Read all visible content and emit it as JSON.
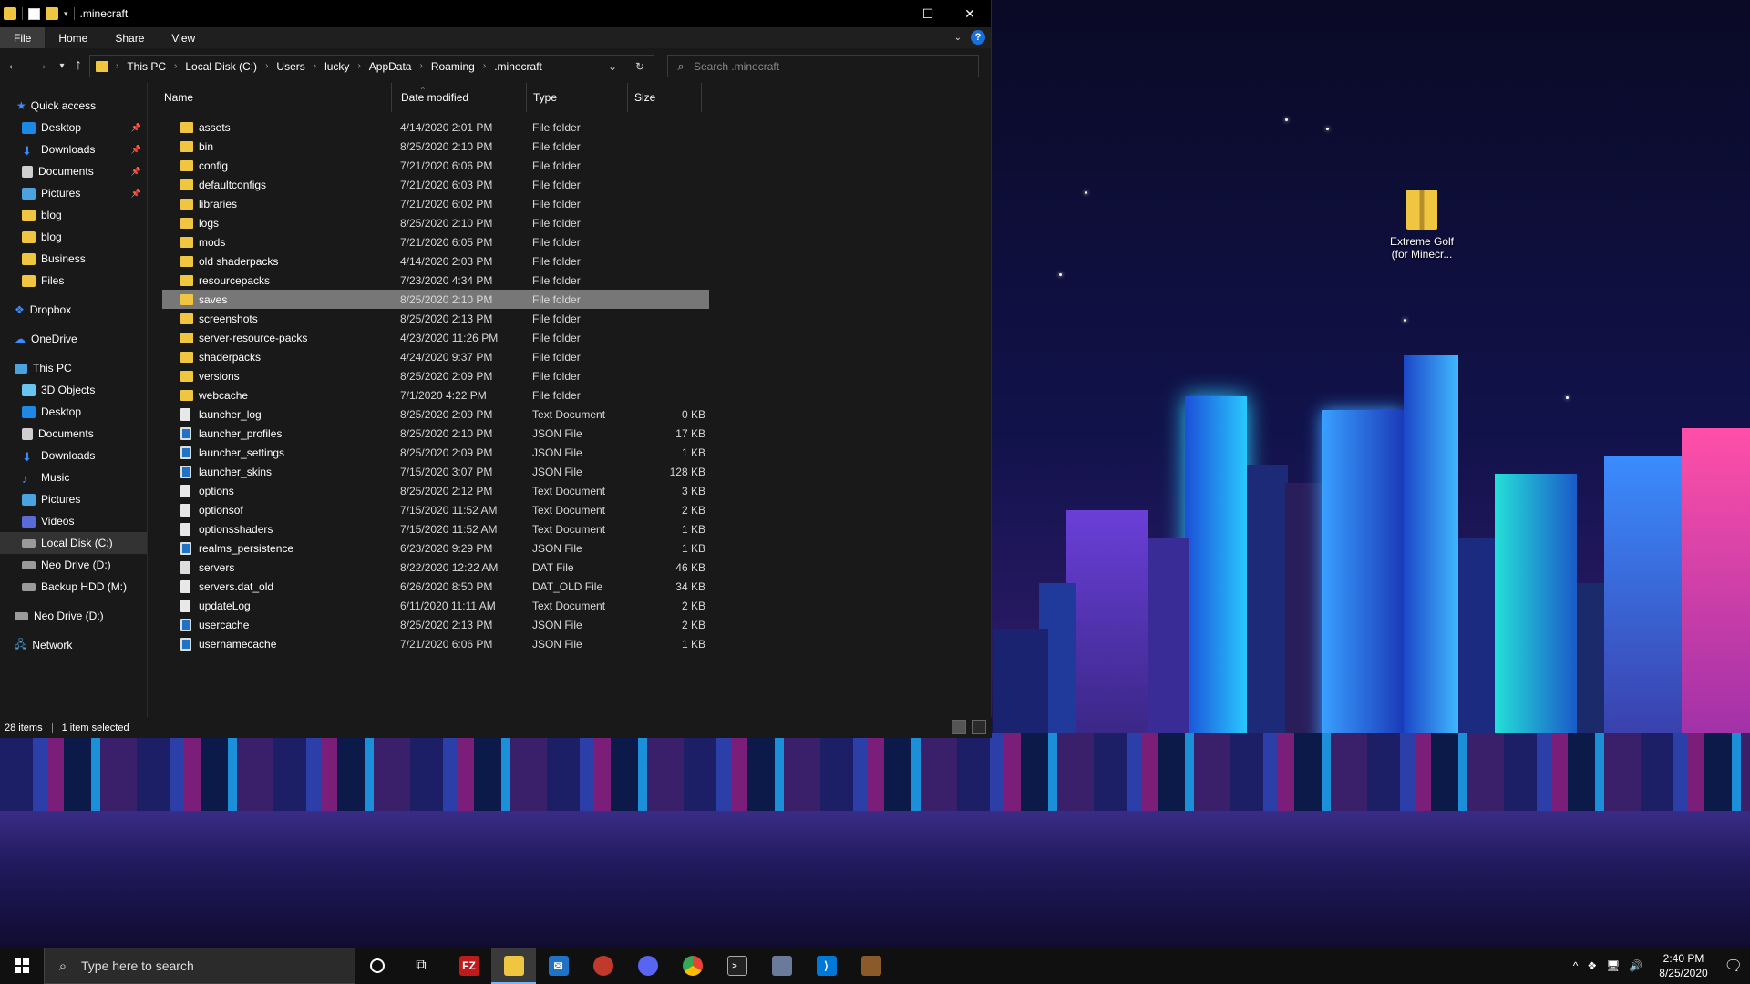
{
  "explorer": {
    "title": ".minecraft",
    "ribbon_tabs": [
      "File",
      "Home",
      "Share",
      "View"
    ],
    "breadcrumb": [
      "This PC",
      "Local Disk (C:)",
      "Users",
      "lucky",
      "AppData",
      "Roaming",
      ".minecraft"
    ],
    "search_placeholder": "Search .minecraft",
    "columns": {
      "name": "Name",
      "date": "Date modified",
      "type": "Type",
      "size": "Size"
    },
    "nav": {
      "quick_access": "Quick access",
      "quick_items": [
        "Desktop",
        "Downloads",
        "Documents",
        "Pictures",
        "blog",
        "blog",
        "Business",
        "Files"
      ],
      "dropbox": "Dropbox",
      "onedrive": "OneDrive",
      "this_pc": "This PC",
      "pc_items": [
        "3D Objects",
        "Desktop",
        "Documents",
        "Downloads",
        "Music",
        "Pictures",
        "Videos",
        "Local Disk (C:)",
        "Neo Drive (D:)",
        "Backup HDD (M:)"
      ],
      "neo_drive": "Neo Drive (D:)",
      "network": "Network"
    },
    "files": [
      {
        "name": "assets",
        "date": "4/14/2020 2:01 PM",
        "type": "File folder",
        "size": "",
        "kind": "folder"
      },
      {
        "name": "bin",
        "date": "8/25/2020 2:10 PM",
        "type": "File folder",
        "size": "",
        "kind": "folder"
      },
      {
        "name": "config",
        "date": "7/21/2020 6:06 PM",
        "type": "File folder",
        "size": "",
        "kind": "folder"
      },
      {
        "name": "defaultconfigs",
        "date": "7/21/2020 6:03 PM",
        "type": "File folder",
        "size": "",
        "kind": "folder"
      },
      {
        "name": "libraries",
        "date": "7/21/2020 6:02 PM",
        "type": "File folder",
        "size": "",
        "kind": "folder"
      },
      {
        "name": "logs",
        "date": "8/25/2020 2:10 PM",
        "type": "File folder",
        "size": "",
        "kind": "folder"
      },
      {
        "name": "mods",
        "date": "7/21/2020 6:05 PM",
        "type": "File folder",
        "size": "",
        "kind": "folder"
      },
      {
        "name": "old shaderpacks",
        "date": "4/14/2020 2:03 PM",
        "type": "File folder",
        "size": "",
        "kind": "folder"
      },
      {
        "name": "resourcepacks",
        "date": "7/23/2020 4:34 PM",
        "type": "File folder",
        "size": "",
        "kind": "folder"
      },
      {
        "name": "saves",
        "date": "8/25/2020 2:10 PM",
        "type": "File folder",
        "size": "",
        "kind": "folder",
        "selected": true
      },
      {
        "name": "screenshots",
        "date": "8/25/2020 2:13 PM",
        "type": "File folder",
        "size": "",
        "kind": "folder"
      },
      {
        "name": "server-resource-packs",
        "date": "4/23/2020 11:26 PM",
        "type": "File folder",
        "size": "",
        "kind": "folder"
      },
      {
        "name": "shaderpacks",
        "date": "4/24/2020 9:37 PM",
        "type": "File folder",
        "size": "",
        "kind": "folder"
      },
      {
        "name": "versions",
        "date": "8/25/2020 2:09 PM",
        "type": "File folder",
        "size": "",
        "kind": "folder"
      },
      {
        "name": "webcache",
        "date": "7/1/2020 4:22 PM",
        "type": "File folder",
        "size": "",
        "kind": "folder"
      },
      {
        "name": "launcher_log",
        "date": "8/25/2020 2:09 PM",
        "type": "Text Document",
        "size": "0 KB",
        "kind": "doc"
      },
      {
        "name": "launcher_profiles",
        "date": "8/25/2020 2:10 PM",
        "type": "JSON File",
        "size": "17 KB",
        "kind": "json"
      },
      {
        "name": "launcher_settings",
        "date": "8/25/2020 2:09 PM",
        "type": "JSON File",
        "size": "1 KB",
        "kind": "json"
      },
      {
        "name": "launcher_skins",
        "date": "7/15/2020 3:07 PM",
        "type": "JSON File",
        "size": "128 KB",
        "kind": "json"
      },
      {
        "name": "options",
        "date": "8/25/2020 2:12 PM",
        "type": "Text Document",
        "size": "3 KB",
        "kind": "doc"
      },
      {
        "name": "optionsof",
        "date": "7/15/2020 11:52 AM",
        "type": "Text Document",
        "size": "2 KB",
        "kind": "doc"
      },
      {
        "name": "optionsshaders",
        "date": "7/15/2020 11:52 AM",
        "type": "Text Document",
        "size": "1 KB",
        "kind": "doc"
      },
      {
        "name": "realms_persistence",
        "date": "6/23/2020 9:29 PM",
        "type": "JSON File",
        "size": "1 KB",
        "kind": "json"
      },
      {
        "name": "servers",
        "date": "8/22/2020 12:22 AM",
        "type": "DAT File",
        "size": "46 KB",
        "kind": "dat"
      },
      {
        "name": "servers.dat_old",
        "date": "6/26/2020 8:50 PM",
        "type": "DAT_OLD File",
        "size": "34 KB",
        "kind": "doc"
      },
      {
        "name": "updateLog",
        "date": "6/11/2020 11:11 AM",
        "type": "Text Document",
        "size": "2 KB",
        "kind": "doc"
      },
      {
        "name": "usercache",
        "date": "8/25/2020 2:13 PM",
        "type": "JSON File",
        "size": "2 KB",
        "kind": "json"
      },
      {
        "name": "usernamecache",
        "date": "7/21/2020 6:06 PM",
        "type": "JSON File",
        "size": "1 KB",
        "kind": "json"
      }
    ],
    "status": {
      "count": "28 items",
      "selected": "1 item selected"
    }
  },
  "desktop_icon": {
    "label_line1": "Extreme Golf",
    "label_line2": "(for Minecr..."
  },
  "taskbar": {
    "search_placeholder": "Type here to search",
    "apps": [
      "filezilla",
      "file-explorer",
      "mail",
      "pdf-app",
      "discord",
      "chrome",
      "terminal",
      "game-app",
      "vscode",
      "minecraft"
    ],
    "time": "2:40 PM",
    "date": "8/25/2020"
  },
  "colors": {
    "folder": "#f0c640",
    "accent": "#1a6fd8",
    "json": "#1e72c8"
  }
}
